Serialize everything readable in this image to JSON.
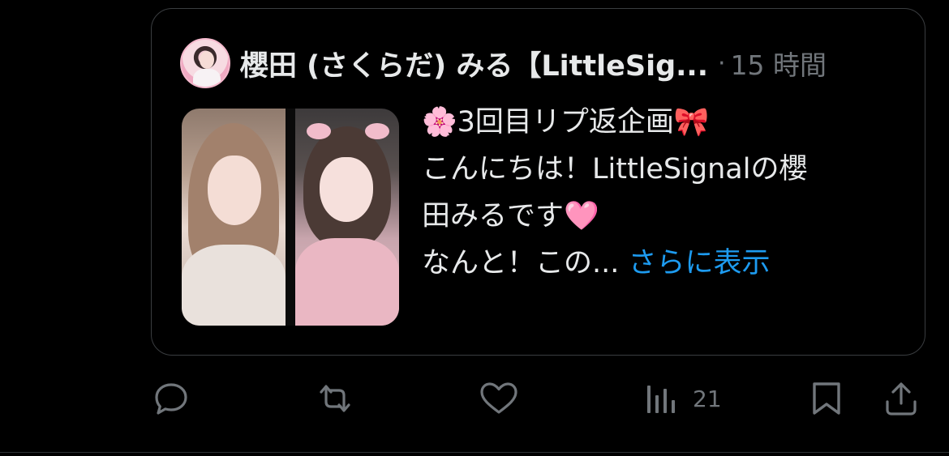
{
  "quote": {
    "author_name": "櫻田 (さくらだ) みる【LittleSig...",
    "separator": "·",
    "timestamp": "15 時間",
    "text_lines": [
      "🌸3回目リプ返企画🎀",
      "こんにちは！LittleSignalの櫻",
      "田みるです🩷",
      "なんと！この..."
    ],
    "show_more": "さらに表示"
  },
  "actions": {
    "reply_icon": "reply-icon",
    "repost_icon": "repost-icon",
    "like_icon": "heart-icon",
    "views_icon": "views-icon",
    "views_count": "21",
    "bookmark_icon": "bookmark-icon",
    "share_icon": "share-icon"
  },
  "colors": {
    "background": "#000000",
    "text": "#e7e9ea",
    "muted": "#71767b",
    "link": "#1d9bf0",
    "border": "#3a3d40"
  }
}
